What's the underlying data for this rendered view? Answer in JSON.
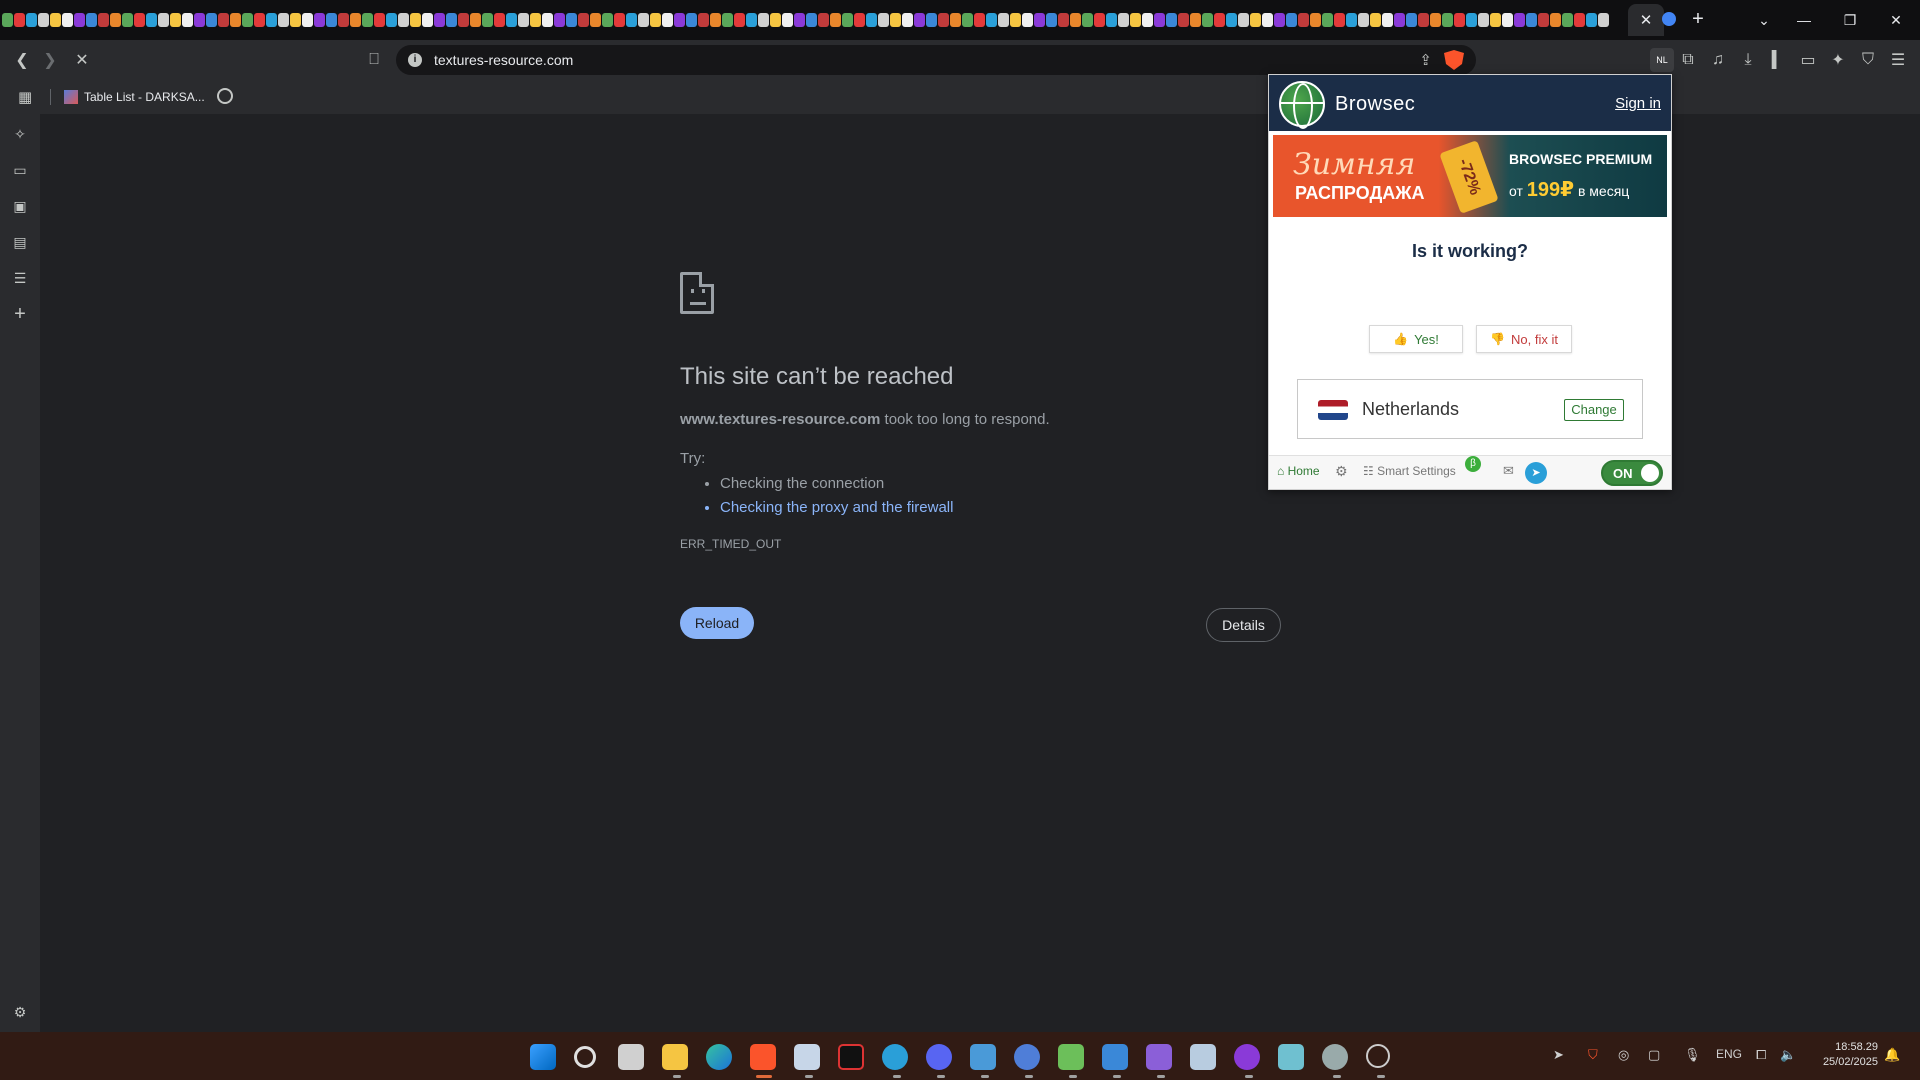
{
  "browser": {
    "active_tab_close": "✕",
    "new_tab": "+",
    "window_controls": {
      "tabsearch": "⌄",
      "minimize": "—",
      "restore": "❐",
      "close": "✕"
    },
    "url": "textures-resource.com",
    "bookmark_item": "Table List - DARKSA...",
    "extension_badge": "NL"
  },
  "error_page": {
    "title": "This site can’t be reached",
    "host": "www.textures-resource.com",
    "desc_rest": " took too long to respond.",
    "try_label": "Try:",
    "suggestions": [
      "Checking the connection",
      "Checking the proxy and the firewall"
    ],
    "error_code": "ERR_TIMED_OUT",
    "reload_label": "Reload",
    "details_label": "Details"
  },
  "browsec": {
    "brand": "Browsec",
    "sign_in": "Sign in",
    "promo": {
      "script_text": "Зимняя",
      "big_text": "РАСПРОДАЖА",
      "discount": "-72%",
      "premium": "BROWSEC PREMIUM",
      "price_prefix": "от ",
      "price": "199₽",
      "price_suffix": " в месяц"
    },
    "question": "Is it working?",
    "yes_label": "Yes!",
    "no_label": "No, fix it",
    "location": "Netherlands",
    "change_label": "Change",
    "footer": {
      "home": "Home",
      "smart_settings": "Smart Settings",
      "beta": "β",
      "toggle": "ON"
    }
  },
  "taskbar": {
    "lang": "ENG",
    "time": "18:58.29",
    "date": "25/02/2025"
  },
  "colors": {
    "accent": "#8ab4f8",
    "browsec_green": "#2f7a34",
    "browsec_navy": "#1b2d47",
    "taskbar": "#311b14"
  }
}
